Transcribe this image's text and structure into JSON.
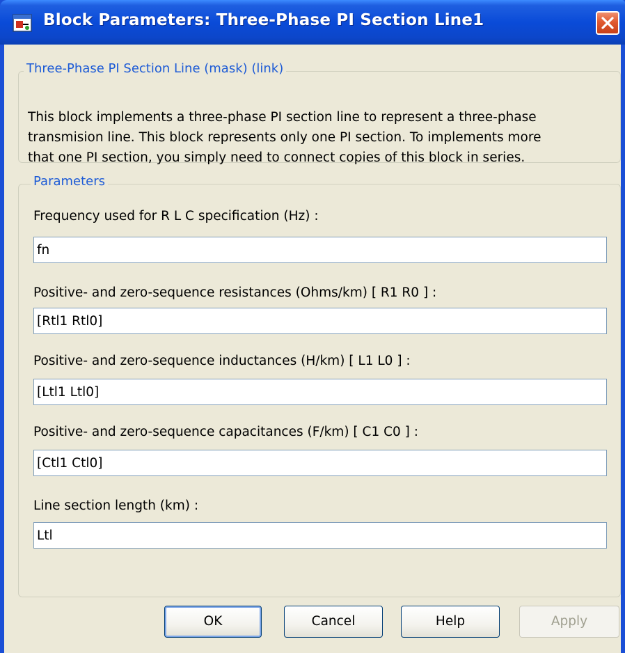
{
  "window": {
    "title": "Block Parameters: Three-Phase PI Section Line1",
    "icon": "simulink-block-icon",
    "close_icon": "close-icon"
  },
  "mask_group": {
    "legend": "Three-Phase PI Section Line (mask) (link)",
    "description_lines": [
      "This block implements a three-phase PI section line to represent a three-phase",
      "transmision line. This block represents only  one PI section.  To implements more",
      "that one PI section,  you simply need to connect  copies of this block in series."
    ]
  },
  "parameters_group": {
    "legend": "Parameters",
    "fields": [
      {
        "label": "Frequency used for R L C specification (Hz) :",
        "value": "fn"
      },
      {
        "label": "Positive- and zero-sequence resistances (Ohms/km)  [ R1  R0 ] :",
        "value": "[Rtl1 Rtl0]"
      },
      {
        "label": "Positive- and zero-sequence inductances (H/km) [ L1  L0 ] :",
        "value": "[Ltl1 Ltl0]"
      },
      {
        "label": "Positive- and zero-sequence capacitances (F/km)  [ C1 C0 ] :",
        "value": "[Ctl1 Ctl0]"
      },
      {
        "label": "Line section length (km) :",
        "value": "Ltl"
      }
    ]
  },
  "buttons": {
    "ok": "OK",
    "cancel": "Cancel",
    "help": "Help",
    "apply": "Apply"
  },
  "colors": {
    "titlebar": "#0a4bd8",
    "dialog_bg": "#ece9d8",
    "legend_text": "#1d5bd6",
    "close_button": "#e15a30"
  }
}
